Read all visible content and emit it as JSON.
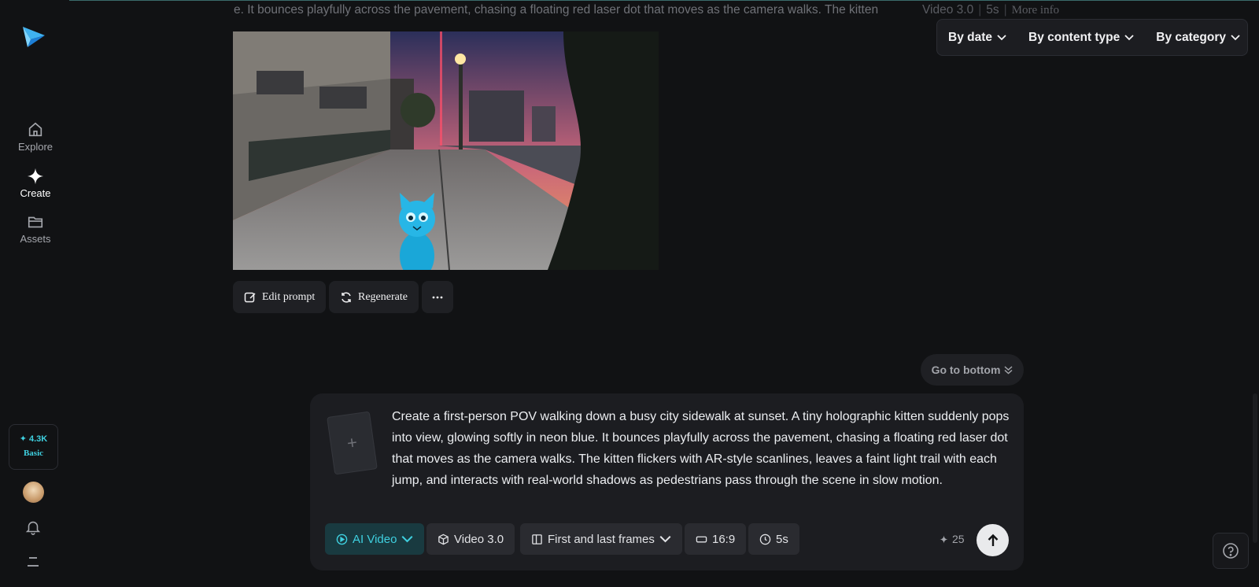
{
  "sidebar": {
    "logo": "paper-plane-logo",
    "items": [
      {
        "label": "Explore",
        "icon": "home-icon",
        "active": false
      },
      {
        "label": "Create",
        "icon": "sparkle-icon",
        "active": true
      },
      {
        "label": "Assets",
        "icon": "folder-icon",
        "active": false
      }
    ],
    "credits": {
      "amount": "✦ 4.3K",
      "plan": "Basic"
    }
  },
  "previous_prompt": {
    "text": "e. It bounces playfully across the pavement, chasing a floating red laser dot that moves as the camera walks. The kitten",
    "model": "Video 3.0",
    "duration": "5s",
    "more_info": "More info"
  },
  "filters": [
    {
      "label": "By date"
    },
    {
      "label": "By content type"
    },
    {
      "label": "By category"
    }
  ],
  "video": {
    "description_icon": "generated-video-thumbnail"
  },
  "actions": {
    "edit_prompt": "Edit prompt",
    "regenerate": "Regenerate"
  },
  "go_to_bottom": "Go to bottom",
  "composer": {
    "prompt": "Create a first-person POV walking down a busy city sidewalk at sunset. A tiny holographic kitten suddenly pops into view, glowing softly in neon blue. It bounces playfully across the pavement, chasing a floating red laser dot that moves as the camera walks. The kitten flickers with AR-style scanlines, leaves a faint light trail with each jump, and interacts with real-world shadows as pedestrians pass through the scene in slow motion.",
    "upload_plus": "+",
    "chips": {
      "mode": "AI Video",
      "model": "Video 3.0",
      "frames": "First and last frames",
      "ratio": "16:9",
      "duration": "5s"
    },
    "cost": "25"
  },
  "colors": {
    "accent": "#3fd0e0",
    "background": "#111214",
    "panel": "#1c1d21"
  }
}
